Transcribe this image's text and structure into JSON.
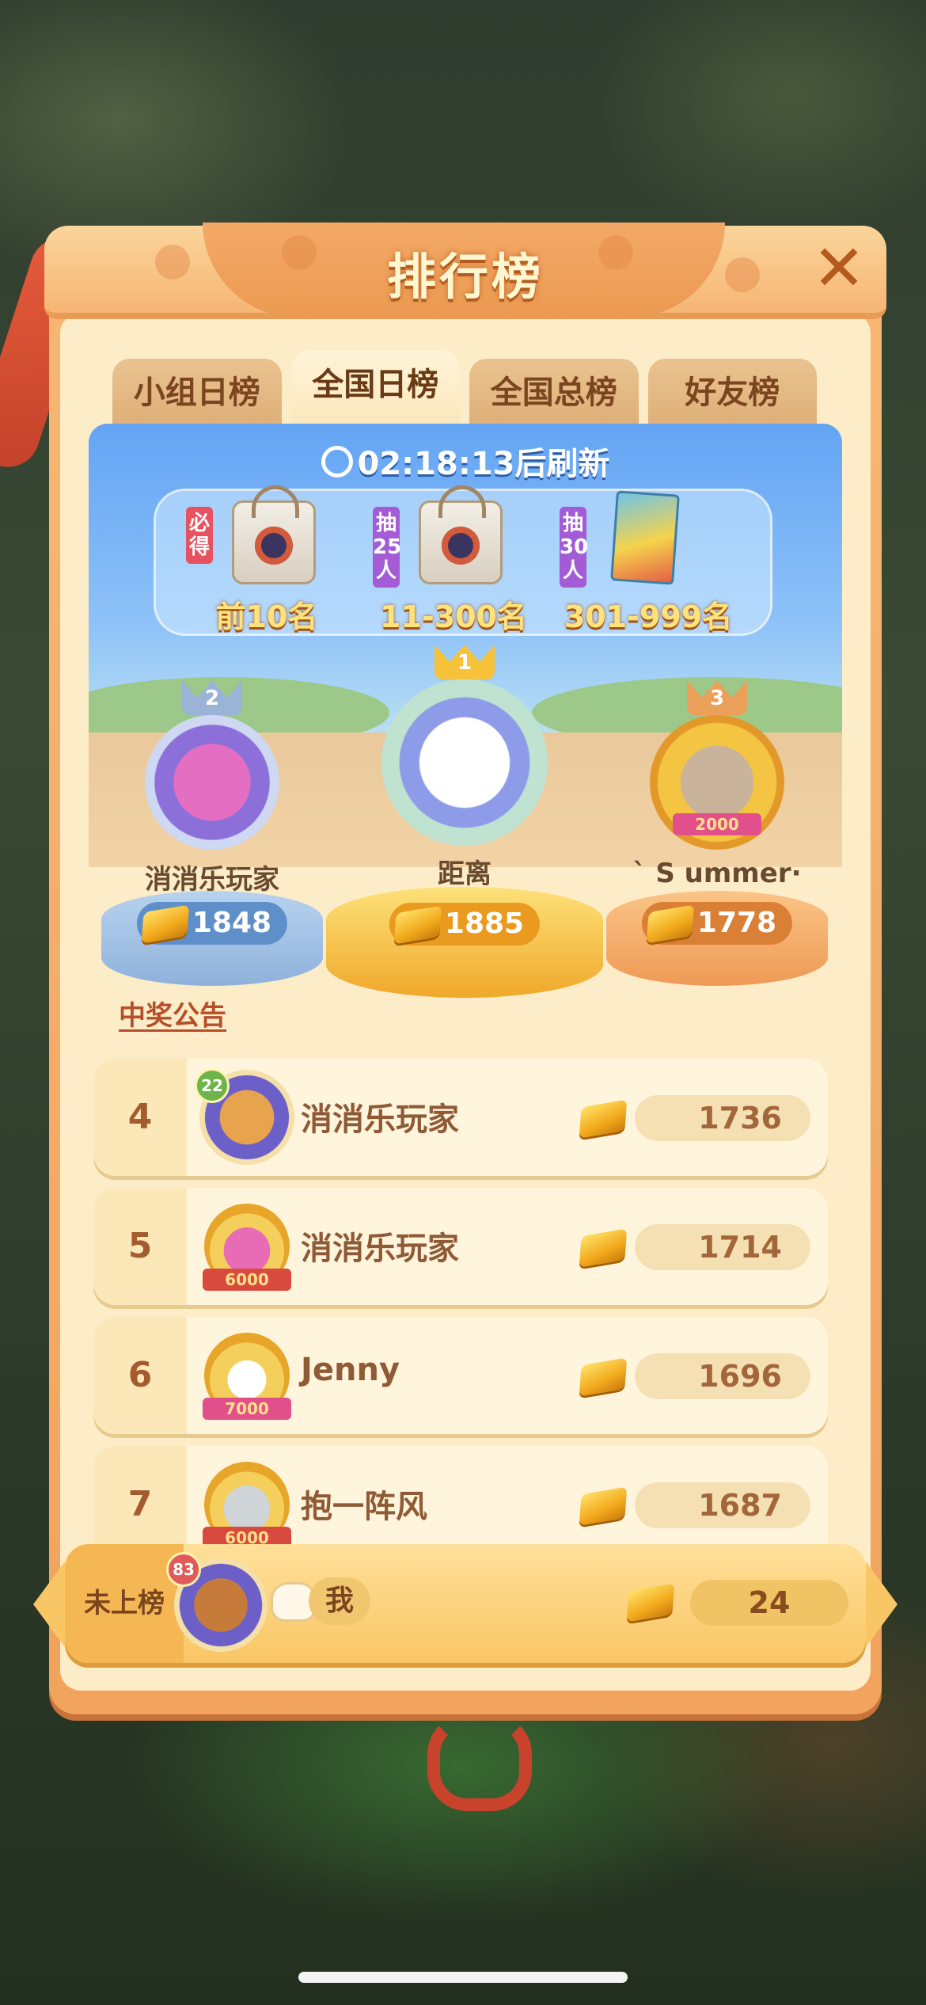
{
  "panel": {
    "title": "排行榜",
    "close_icon": "close-icon"
  },
  "tabs": [
    {
      "label": "小组日榜",
      "active": false
    },
    {
      "label": "全国日榜",
      "active": true
    },
    {
      "label": "全国总榜",
      "active": false
    },
    {
      "label": "好友榜",
      "active": false
    }
  ],
  "refresh": {
    "time": "02:18:13",
    "suffix": "后刷新"
  },
  "prizes": [
    {
      "tag": "必得",
      "label": "前10名",
      "item": "gift-bag"
    },
    {
      "tag": "抽25人",
      "label": "11-300名",
      "item": "gift-bag"
    },
    {
      "tag": "抽30人",
      "label": "301-999名",
      "item": "book"
    }
  ],
  "podium": [
    {
      "rank": "2",
      "name": "消消乐玩家",
      "score": "1848"
    },
    {
      "rank": "1",
      "name": "距离",
      "score": "1885"
    },
    {
      "rank": "3",
      "name": "ˋ S ummer·",
      "score": "1778",
      "frame_label": "2000"
    }
  ],
  "announcement": "中奖公告",
  "list": [
    {
      "rank": "4",
      "name": "消消乐玩家",
      "score": "1736",
      "level": "22"
    },
    {
      "rank": "5",
      "name": "消消乐玩家",
      "score": "1714",
      "frame_label": "6000"
    },
    {
      "rank": "6",
      "name": "Jenny",
      "score": "1696",
      "frame_label": "7000"
    },
    {
      "rank": "7",
      "name": "抱一阵风",
      "score": "1687",
      "frame_label": "6000"
    }
  ],
  "self": {
    "rank_label": "未上榜",
    "name": "我",
    "score": "24",
    "level": "83"
  },
  "colors": {
    "panel": "#f2a35e",
    "sky": "#63a4f4",
    "gold": "#f2a91c",
    "cream": "#fcecc8"
  }
}
